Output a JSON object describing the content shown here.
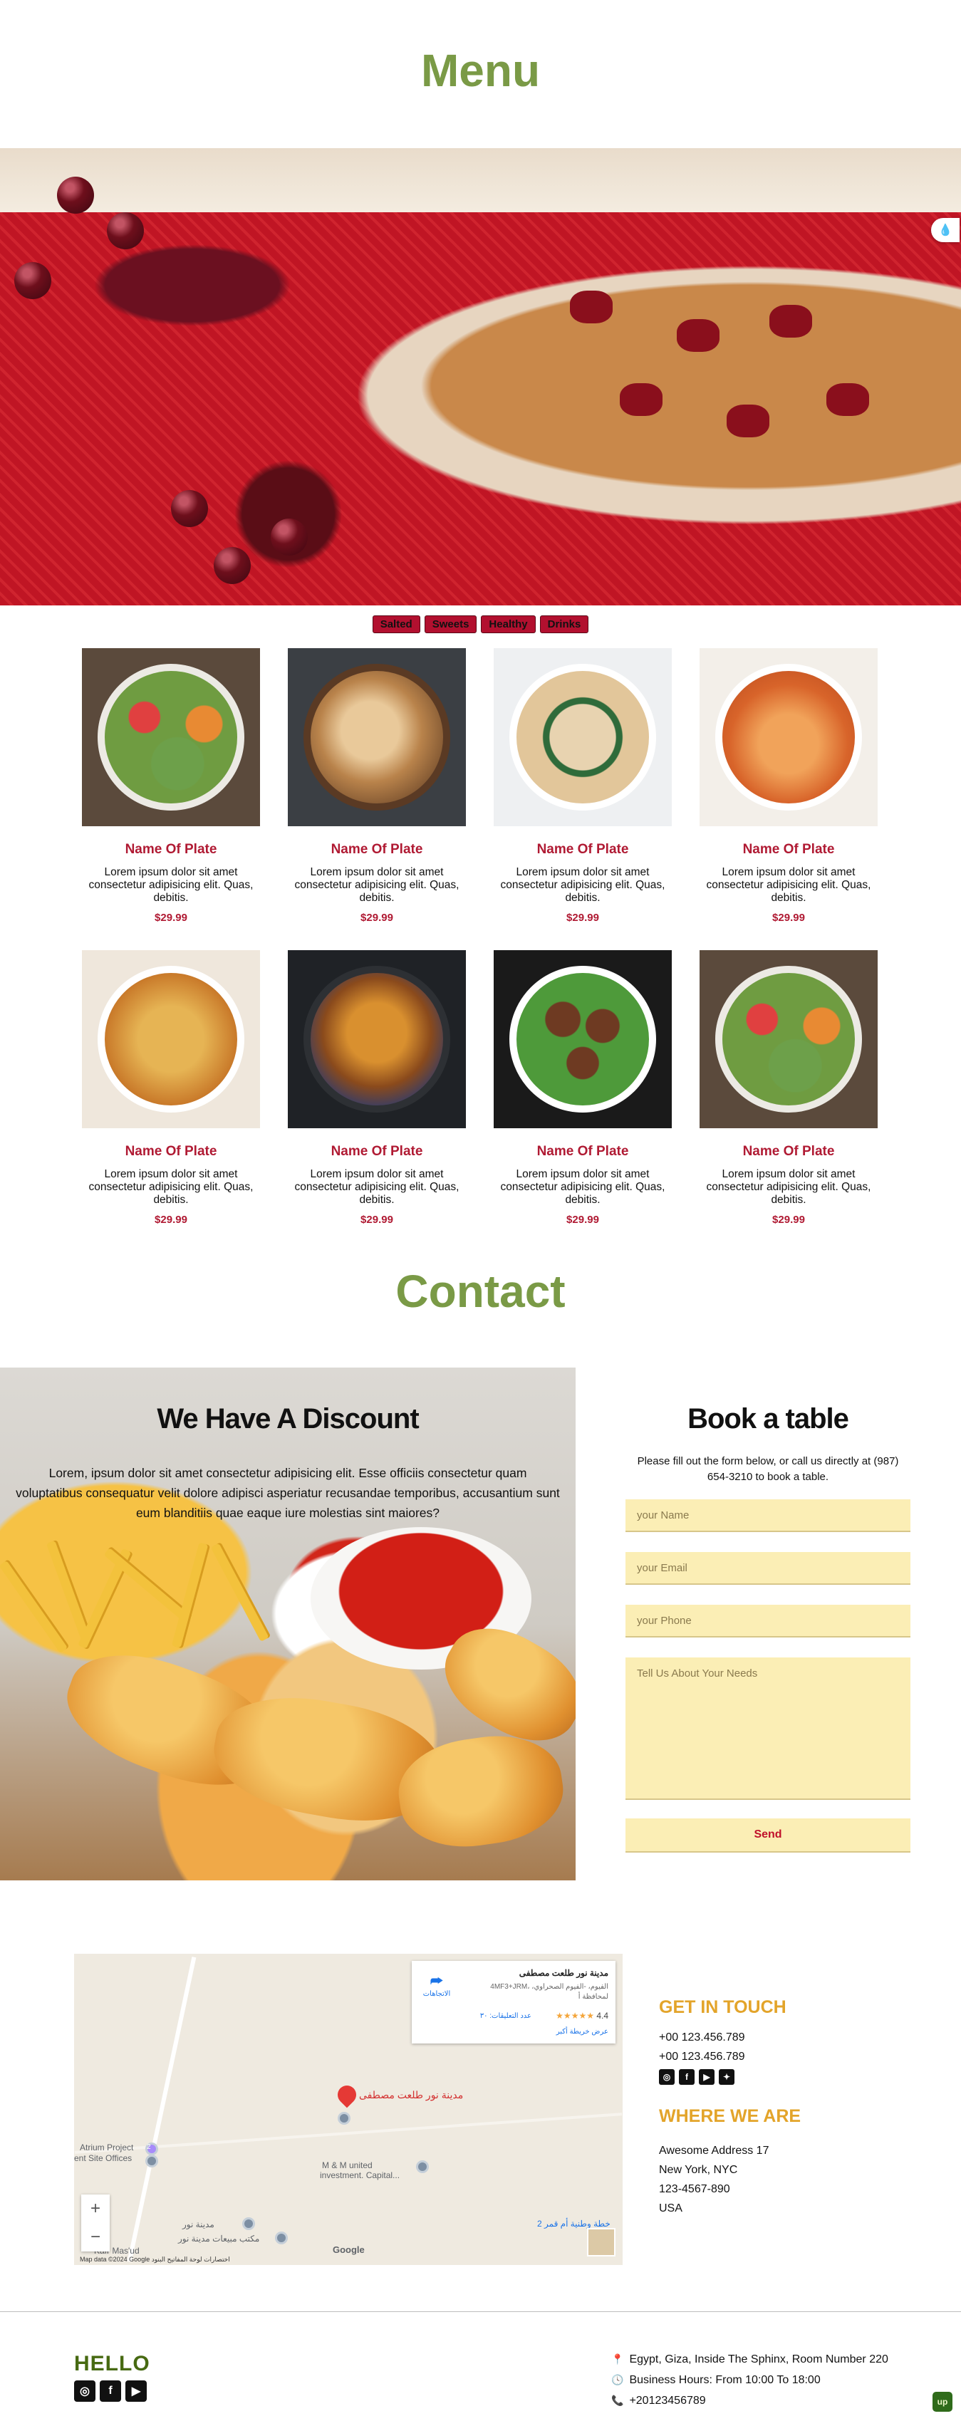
{
  "menu": {
    "title": "Menu",
    "filters": [
      "Salted",
      "Sweets",
      "Healthy",
      "Drinks"
    ],
    "items": [
      {
        "name": "Name Of Plate",
        "desc": "Lorem ipsum dolor sit amet consectetur adipisicing elit. Quas, debitis.",
        "price": "$29.99",
        "image": "veggie-bowl"
      },
      {
        "name": "Name Of Plate",
        "desc": "Lorem ipsum dolor sit amet consectetur adipisicing elit. Quas, debitis.",
        "price": "$29.99",
        "image": "grilled-chicken"
      },
      {
        "name": "Name Of Plate",
        "desc": "Lorem ipsum dolor sit amet consectetur adipisicing elit. Quas, debitis.",
        "price": "$29.99",
        "image": "pasta-greens"
      },
      {
        "name": "Name Of Plate",
        "desc": "Lorem ipsum dolor sit amet consectetur adipisicing elit. Quas, debitis.",
        "price": "$29.99",
        "image": "spaghetti-fork"
      },
      {
        "name": "Name Of Plate",
        "desc": "Lorem ipsum dolor sit amet consectetur adipisicing elit. Quas, debitis.",
        "price": "$29.99",
        "image": "pasta-cheese"
      },
      {
        "name": "Name Of Plate",
        "desc": "Lorem ipsum dolor sit amet consectetur adipisicing elit. Quas, debitis.",
        "price": "$29.99",
        "image": "french-toast"
      },
      {
        "name": "Name Of Plate",
        "desc": "Lorem ipsum dolor sit amet consectetur adipisicing elit. Quas, debitis.",
        "price": "$29.99",
        "image": "meatballs"
      },
      {
        "name": "Name Of Plate",
        "desc": "Lorem ipsum dolor sit amet consectetur adipisicing elit. Quas, debitis.",
        "price": "$29.99",
        "image": "veggie-bowl"
      }
    ]
  },
  "contact": {
    "title": "Contact",
    "discount": {
      "heading": "We Have A Discount",
      "text": "Lorem, ipsum dolor sit amet consectetur adipisicing elit. Esse officiis consectetur quam voluptatibus consequatur velit dolore adipisci asperiatur recusandae temporibus, accusantium sunt eum blanditiis quae eaque iure molestias sint maiores?"
    },
    "booking": {
      "heading": "Book a table",
      "intro": "Please fill out the form below, or call us directly at (987) 654-3210 to book a table.",
      "name_placeholder": "your Name",
      "email_placeholder": "your Email",
      "phone_placeholder": "your Phone",
      "needs_placeholder": "Tell Us About Your Needs",
      "send_label": "Send"
    }
  },
  "map": {
    "place_name": "مدينة نور طلعت مصطفى",
    "address": "4MF3+JRM، الفيوم، -الفيوم الصحراوي، لمحافظة أ",
    "rating": "4.4",
    "stars": "★★★★★",
    "reviews": "عدد التعليقات: ٣٠",
    "larger_map": "عرض خريطة أكبر",
    "directions": "الاتجاهات",
    "pin_label": "مدينة نور طلعت مصطفى",
    "labels": {
      "atrium": "Atrium Project",
      "atrium2": "ent Site Offices",
      "mm": "M & M united",
      "mm2": "investment. Capital...",
      "noor": "مدينة نور",
      "office": "مكتب مبيعات مدينة نور",
      "kafr": "Kafr Mas'ud",
      "plan": "خطة وطنية أم قمر 2",
      "badge": "2"
    },
    "zoom_in": "+",
    "zoom_out": "−",
    "google": "Google",
    "attribution": "Map data ©2024 Google   اختصارات لوحة المفاتيح   البنود"
  },
  "touch": {
    "heading": "GET IN TOUCH",
    "phone1": "+00 123.456.789",
    "phone2": "+00 123.456.789",
    "socials": [
      "instagram-icon",
      "facebook-icon",
      "youtube-icon",
      "twitter-icon"
    ],
    "where_heading": "WHERE WE ARE",
    "address": [
      "Awesome Address 17",
      "New York, NYC",
      "123-4567-890",
      "USA"
    ]
  },
  "footer": {
    "hello": "HELLO",
    "address": "Egypt, Giza, Inside The Sphinx, Room Number 220",
    "hours": "Business Hours: From 10:00 To 18:00",
    "phone": "+20123456789",
    "up": "up"
  },
  "colors": {
    "accent_green": "#7a9a46",
    "plate_red": "#b01a33",
    "touch_orange": "#e3a42a",
    "form_yellow": "#fbeeb5",
    "hello_green": "#476a12"
  }
}
